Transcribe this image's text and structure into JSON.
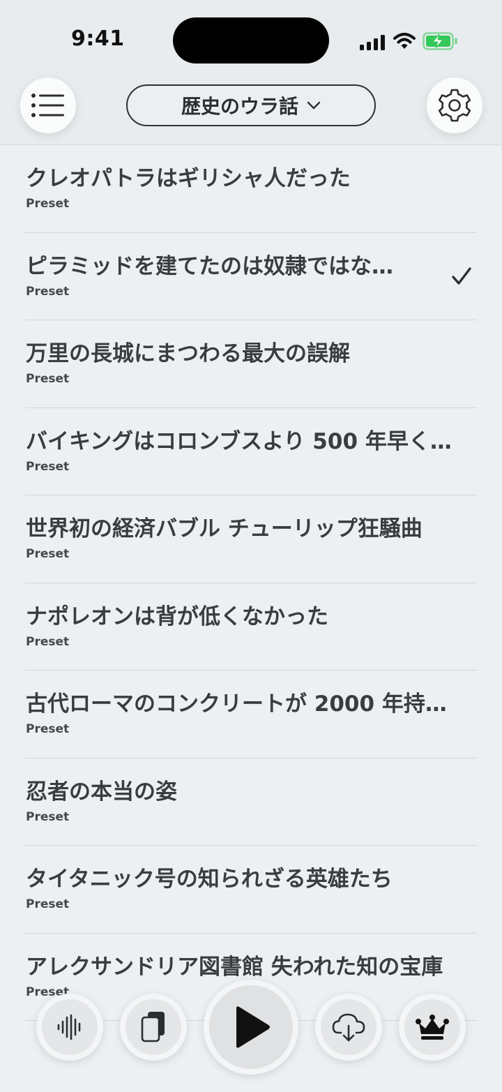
{
  "status_bar": {
    "time": "9:41"
  },
  "header": {
    "category": "歴史のウラ話"
  },
  "list": {
    "items": [
      {
        "title": "クレオパトラはギリシャ人だった",
        "subtitle": "Preset",
        "selected": false
      },
      {
        "title": "ピラミッドを建てたのは奴隷ではな…",
        "subtitle": "Preset",
        "selected": true
      },
      {
        "title": "万里の長城にまつわる最大の誤解",
        "subtitle": "Preset",
        "selected": false
      },
      {
        "title": "バイキングはコロンブスより 500 年早く…",
        "subtitle": "Preset",
        "selected": false
      },
      {
        "title": "世界初の経済バブル チューリップ狂騒曲",
        "subtitle": "Preset",
        "selected": false
      },
      {
        "title": "ナポレオンは背が低くなかった",
        "subtitle": "Preset",
        "selected": false
      },
      {
        "title": "古代ローマのコンクリートが 2000 年持…",
        "subtitle": "Preset",
        "selected": false
      },
      {
        "title": "忍者の本当の姿",
        "subtitle": "Preset",
        "selected": false
      },
      {
        "title": "タイタニック号の知られざる英雄たち",
        "subtitle": "Preset",
        "selected": false
      },
      {
        "title": "アレクサンドリア図書館 失われた知の宝庫",
        "subtitle": "Preset",
        "selected": false
      }
    ]
  },
  "player_bar": {
    "buttons": [
      "waveform-icon",
      "cards-icon",
      "play-icon",
      "cloud-download-icon",
      "crown-icon"
    ]
  },
  "colors": {
    "background": "#edf0f2",
    "text": "#3a3c3f",
    "battery": "#34c759"
  }
}
